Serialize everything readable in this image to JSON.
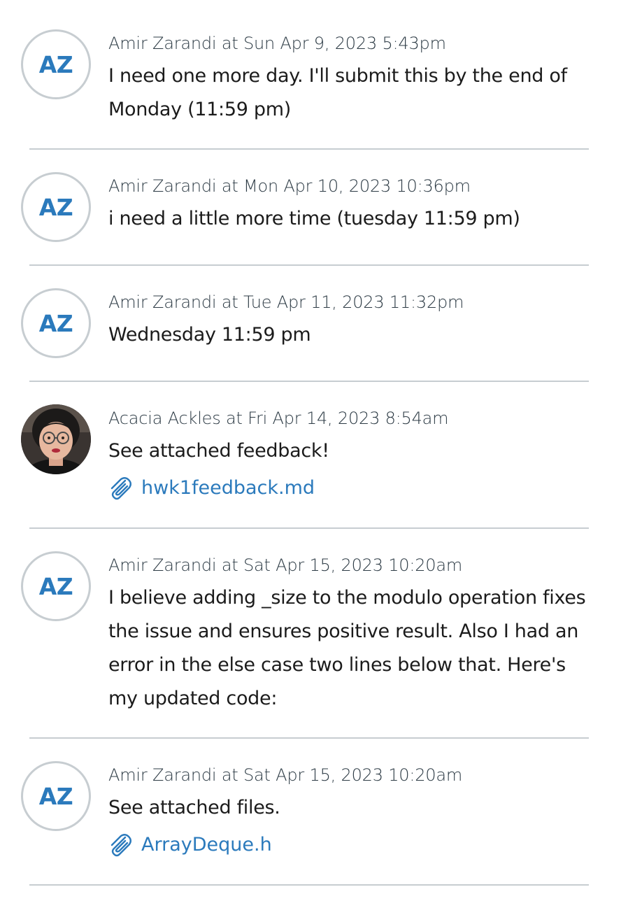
{
  "comments": [
    {
      "avatar_initials": "AZ",
      "meta": "Amir Zarandi at Sun Apr 9, 2023 5:43pm",
      "body_lines": [
        "I need one more day. I'll submit this by the end of",
        "Monday (11:59 pm)"
      ]
    },
    {
      "avatar_initials": "AZ",
      "meta": "Amir Zarandi at Mon Apr 10, 2023 10:36pm",
      "body_lines": [
        "i need a little more time (tuesday 11:59 pm)"
      ]
    },
    {
      "avatar_initials": "AZ",
      "meta": "Amir Zarandi at Tue Apr 11, 2023 11:32pm",
      "body_lines": [
        "Wednesday 11:59 pm"
      ]
    },
    {
      "avatar_photo": "profile-photo",
      "meta": "Acacia Ackles at Fri Apr 14, 2023 8:54am",
      "body_lines": [
        "See attached feedback!"
      ],
      "attachment": {
        "icon": "paperclip-icon",
        "label": "hwk1feedback.md"
      }
    },
    {
      "avatar_initials": "AZ",
      "meta": "Amir Zarandi at Sat Apr 15, 2023 10:20am",
      "body_lines": [
        "I believe adding _size to the modulo operation fixes",
        "the issue and ensures positive result. Also I had an",
        "error in the else case two lines below that. Here's",
        "my updated code:"
      ]
    },
    {
      "avatar_initials": "AZ",
      "meta": "Amir Zarandi at Sat Apr 15, 2023 10:20am",
      "body_lines": [
        "See attached files."
      ],
      "attachment": {
        "icon": "paperclip-icon",
        "label": "ArrayDeque.h"
      }
    }
  ],
  "colors": {
    "accent": "#2b7abc",
    "divider": "#c7cdd1",
    "text": "#1b1b1b",
    "meta_text": "#2d3b45"
  }
}
